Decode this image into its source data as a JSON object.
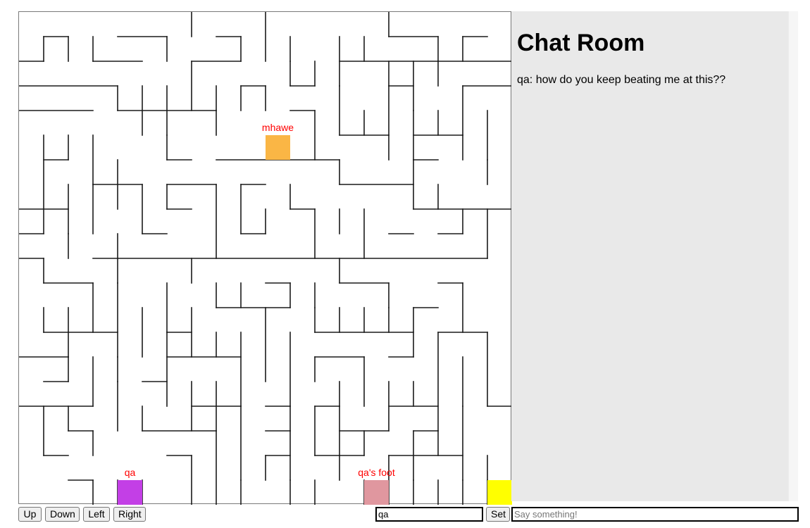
{
  "maze": {
    "cols": 20,
    "rows": 20,
    "wall_color": "#1a1a1a",
    "players": [
      {
        "label": "mhawe",
        "col": 10,
        "row": 5,
        "color": "#fab645",
        "label_color": "#ff0000"
      },
      {
        "label": "qa",
        "col": 4,
        "row": 19,
        "color": "#c33fe6",
        "label_color": "#ff0000"
      },
      {
        "label": "qa's foot",
        "col": 14,
        "row": 19,
        "color": "#e0979f",
        "label_color": "#ff0000"
      }
    ],
    "goal": {
      "col": 19,
      "row": 19,
      "color": "#ffff00"
    }
  },
  "chat": {
    "title": "Chat Room",
    "messages": [
      {
        "text": "qa: how do you keep beating me at this??"
      }
    ],
    "input_placeholder": "Say something!"
  },
  "controls": {
    "up": "Up",
    "down": "Down",
    "left": "Left",
    "right": "Right",
    "name_value": "qa",
    "set": "Set"
  }
}
